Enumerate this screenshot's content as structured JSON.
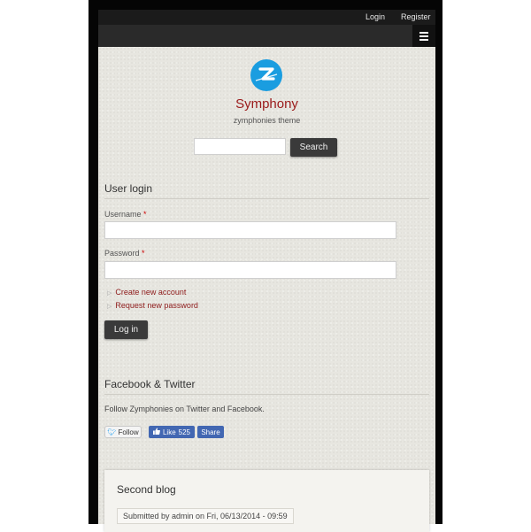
{
  "topbar": {
    "login_label": "Login",
    "register_label": "Register"
  },
  "navbar": {
    "menu_icon": "hamburger-menu-icon"
  },
  "site": {
    "name": "Symphony",
    "slogan": "zymphonies theme",
    "logo_icon": "z-logo-icon",
    "logo_letter": "Z"
  },
  "search": {
    "value": "",
    "button_label": "Search"
  },
  "login_block": {
    "title": "User login",
    "username_label": "Username",
    "password_label": "Password",
    "required_mark": "*",
    "username_value": "",
    "password_value": "",
    "links": [
      "Create new account",
      "Request new password"
    ],
    "submit_label": "Log in"
  },
  "social_block": {
    "title": "Facebook & Twitter",
    "text": "Follow Zymphonies on Twitter and Facebook.",
    "twitter_label": "Follow",
    "like_label": "Like",
    "like_count": "525",
    "share_label": "Share"
  },
  "post": {
    "title": "Second blog",
    "meta": "Submitted by admin on Fri, 06/13/2014 - 09:59"
  },
  "colors": {
    "accent": "#1a9de0",
    "link": "#8e1a1a",
    "site_name": "#9a1a1a",
    "button": "#3a3a3a",
    "facebook": "#4267b2"
  }
}
